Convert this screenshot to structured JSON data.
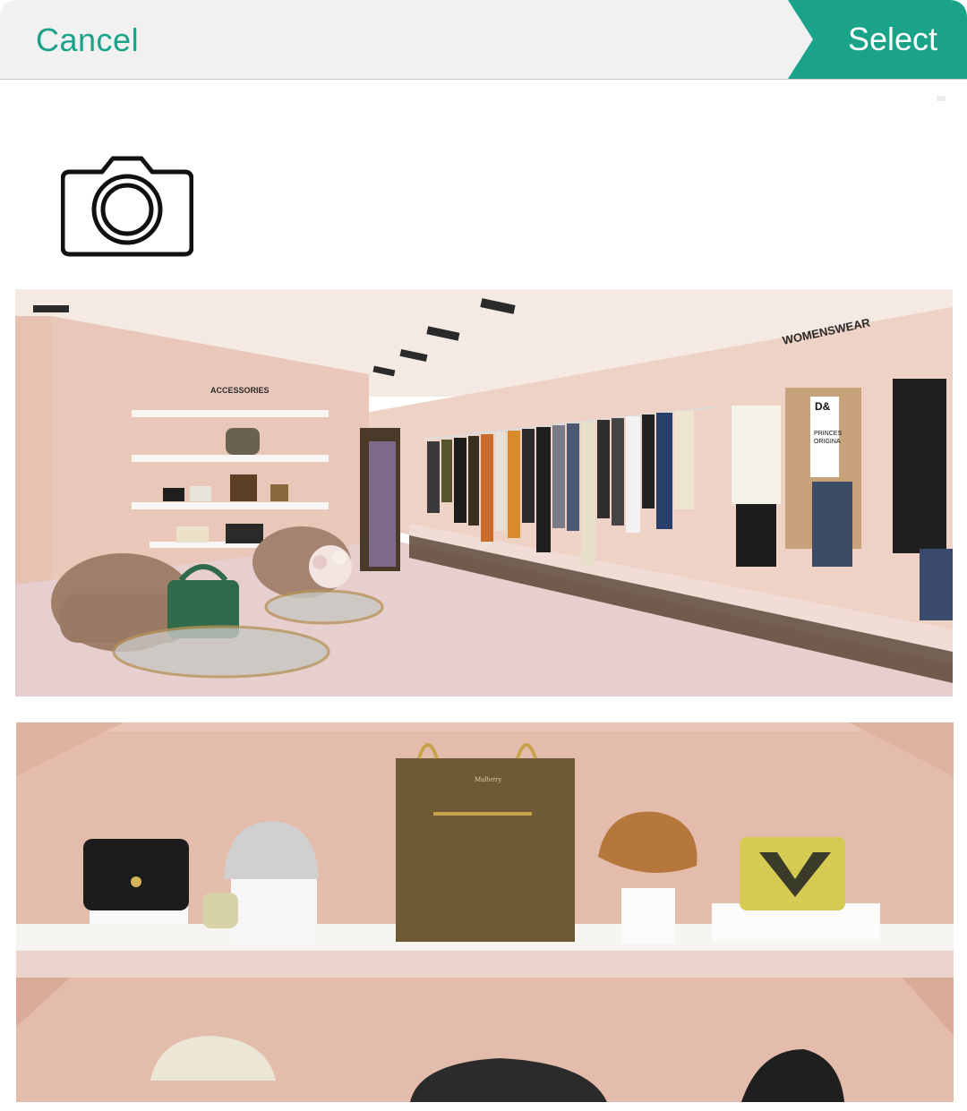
{
  "header": {
    "cancel_label": "Cancel",
    "select_label": "Select"
  },
  "icons": {
    "camera": "camera-icon"
  },
  "gallery": {
    "photo_1": {
      "signs": [
        "ACCESSORIES",
        "WOMENSWEAR"
      ],
      "tshirt_text": [
        "D&",
        "PRINCES",
        "ORIGINA"
      ]
    },
    "photo_2": {
      "bag_label": "Mulberry"
    }
  },
  "colors": {
    "accent": "#1aa389",
    "header_bg": "#f1f1f1",
    "wall_pink": "#e8c4b4"
  }
}
